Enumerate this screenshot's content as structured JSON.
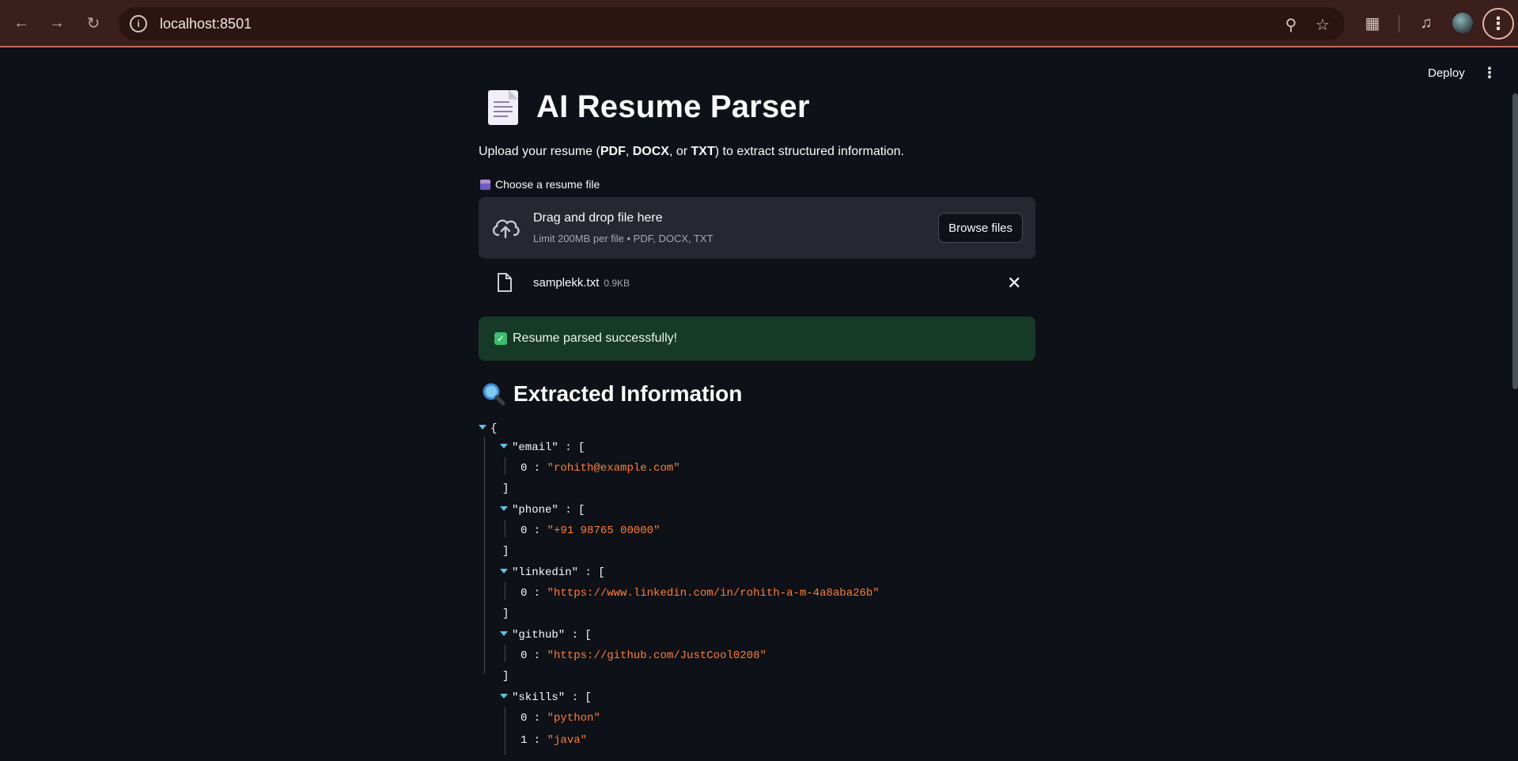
{
  "browser": {
    "url": "localhost:8501"
  },
  "app_header": {
    "deploy_label": "Deploy"
  },
  "page": {
    "title": "AI Resume Parser",
    "subtitle_prefix": "Upload your resume (",
    "subtitle_pdf": "PDF",
    "subtitle_sep1": ", ",
    "subtitle_docx": "DOCX",
    "subtitle_sep2": ", or ",
    "subtitle_txt": "TXT",
    "subtitle_suffix": ") to extract structured information."
  },
  "uploader": {
    "label": "Choose a resume file",
    "drag_text": "Drag and drop file here",
    "limit_text": "Limit 200MB per file • PDF, DOCX, TXT",
    "browse_label": "Browse files",
    "file_name": "samplekk.txt",
    "file_size": "0.9KB"
  },
  "status": {
    "success_message": "Resume parsed successfully!"
  },
  "results": {
    "section_title": "Extracted Information",
    "json": {
      "email": [
        "rohith@example.com"
      ],
      "phone": [
        "+91 98765 00000"
      ],
      "linkedin": [
        "https://www.linkedin.com/in/rohith-a-m-4a8aba26b"
      ],
      "github": [
        "https://github.com/JustCool0208"
      ],
      "skills": [
        "python",
        "java"
      ]
    }
  },
  "colors": {
    "background": "#0e1117",
    "dropzone": "#262730",
    "success_bg": "#173928",
    "json_string": "#ff7f3a",
    "json_caret": "#5cc4e6"
  }
}
